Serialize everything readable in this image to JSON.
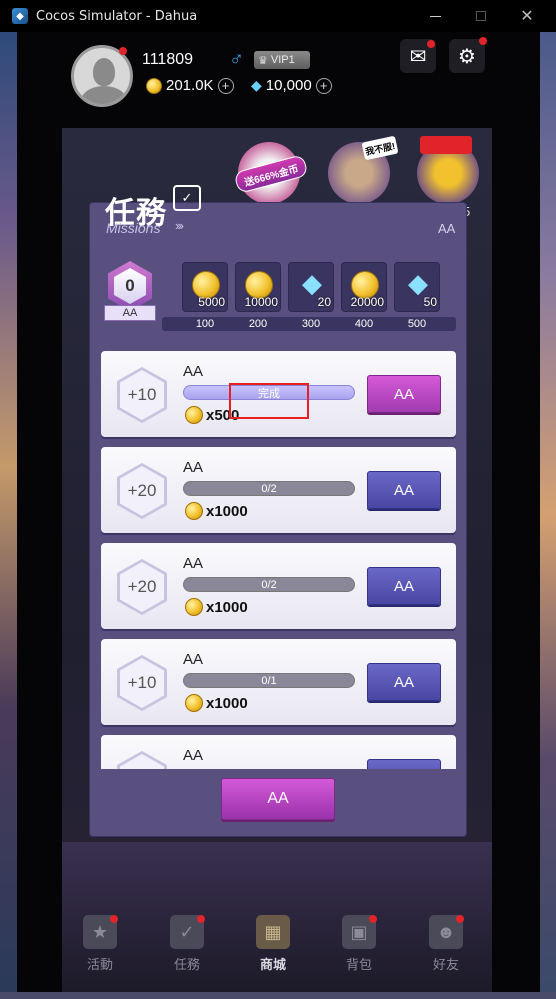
{
  "window": {
    "title": "Cocos Simulator - Dahua"
  },
  "header": {
    "user_id": "111809",
    "gender_symbol": "♂",
    "vip_label": "VIP1",
    "gold": "201.0K",
    "diamonds": "10,000"
  },
  "promos": {
    "badge_text": "送666%金币",
    "tag_text": "我不服!",
    "edge_text": "5"
  },
  "modal": {
    "title": "任務",
    "subtitle": "Missions",
    "corner_label": "AA",
    "points": "0",
    "points_label": "AA",
    "rewards": [
      {
        "type": "coin",
        "amount": "5000",
        "threshold": "100"
      },
      {
        "type": "coin",
        "amount": "10000",
        "threshold": "200"
      },
      {
        "type": "diamond",
        "amount": "20",
        "threshold": "300"
      },
      {
        "type": "coin",
        "amount": "20000",
        "threshold": "400"
      },
      {
        "type": "diamond",
        "amount": "50",
        "threshold": "500"
      }
    ],
    "missions": [
      {
        "points": "+10",
        "title": "AA",
        "progress_text": "完成",
        "reward": "x500",
        "button": "AA",
        "state": "claim"
      },
      {
        "points": "+20",
        "title": "AA",
        "progress_text": "0/2",
        "reward": "x1000",
        "button": "AA",
        "state": "go"
      },
      {
        "points": "+20",
        "title": "AA",
        "progress_text": "0/2",
        "reward": "x1000",
        "button": "AA",
        "state": "go"
      },
      {
        "points": "+10",
        "title": "AA",
        "progress_text": "0/1",
        "reward": "x1000",
        "button": "AA",
        "state": "go"
      },
      {
        "points": "",
        "title": "AA",
        "progress_text": "",
        "reward": "",
        "button": "",
        "state": "go"
      }
    ],
    "main_button": "AA"
  },
  "nav": {
    "items": [
      {
        "label": "活動",
        "icon": "ticket-icon"
      },
      {
        "label": "任務",
        "icon": "calendar-icon"
      },
      {
        "label": "商城",
        "icon": "cart-icon"
      },
      {
        "label": "背包",
        "icon": "bag-icon"
      },
      {
        "label": "好友",
        "icon": "friends-icon"
      }
    ],
    "active_index": 2
  },
  "colors": {
    "modal_bg": "#5a5080",
    "claim_button": "#c44ac8",
    "go_button": "#5a56b8",
    "highlight": "#e82020"
  }
}
